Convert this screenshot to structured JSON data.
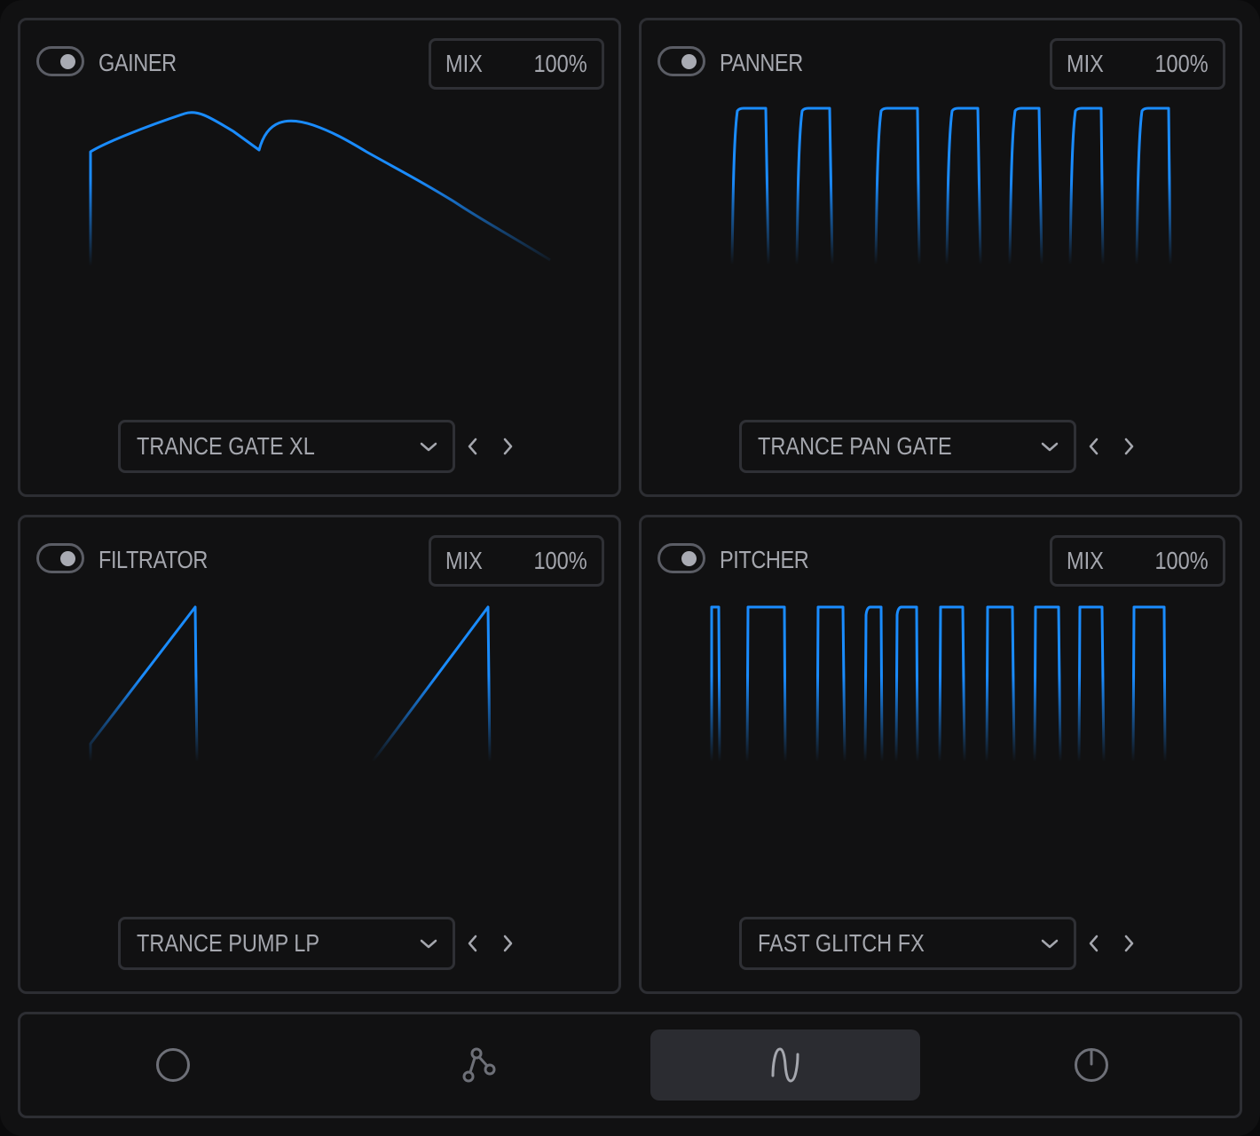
{
  "modules": [
    {
      "title": "GAINER",
      "mix_label": "MIX",
      "mix_value": "100%",
      "preset": "TRANCE GATE XL"
    },
    {
      "title": "PANNER",
      "mix_label": "MIX",
      "mix_value": "100%",
      "preset": "TRANCE PAN GATE"
    },
    {
      "title": "FILTRATOR",
      "mix_label": "MIX",
      "mix_value": "100%",
      "preset": "TRANCE PUMP LP"
    },
    {
      "title": "PITCHER",
      "mix_label": "MIX",
      "mix_value": "100%",
      "preset": "FAST GLITCH FX"
    }
  ],
  "bottom_tabs": [
    {
      "icon": "circle-icon",
      "active": false
    },
    {
      "icon": "nodes-icon",
      "active": false
    },
    {
      "icon": "sine-wave-icon",
      "active": true
    },
    {
      "icon": "power-icon",
      "active": false
    }
  ],
  "colors": {
    "accent": "#1a8cff",
    "panel_border": "#2d2e33",
    "text": "#a5a7ae",
    "background": "#111112"
  }
}
